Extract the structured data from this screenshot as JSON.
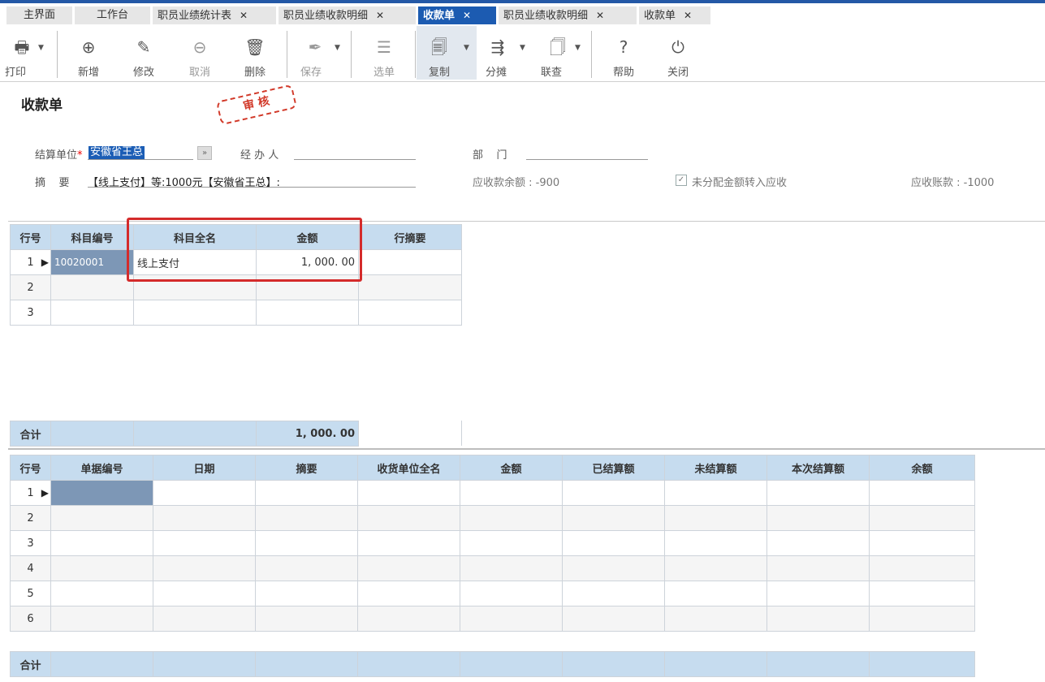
{
  "tabs": [
    {
      "label": "主界面",
      "closable": false,
      "active": false
    },
    {
      "label": "工作台",
      "closable": false,
      "active": false
    },
    {
      "label": "职员业绩统计表",
      "closable": true,
      "active": false
    },
    {
      "label": "职员业绩收款明细",
      "closable": true,
      "active": false
    },
    {
      "label": "收款单",
      "closable": true,
      "active": true
    },
    {
      "label": "职员业绩收款明细",
      "closable": true,
      "active": false
    },
    {
      "label": "收款单",
      "closable": true,
      "active": false
    }
  ],
  "close_glyph": "✕",
  "toolbar": {
    "print": "打印",
    "add": "新增",
    "edit": "修改",
    "cancel": "取消",
    "delete": "删除",
    "save": "保存",
    "select": "选单",
    "copy": "复制",
    "split": "分摊",
    "query": "联查",
    "help": "帮助",
    "close": "关闭"
  },
  "form": {
    "title": "收款单",
    "stamp": "审 核",
    "settle_unit_label": "结算单位",
    "required_mark": "*",
    "settle_unit_value": "安徽省王总",
    "handler_label": "经 办 人",
    "dept_label": "部    门",
    "summary_label": "摘    要",
    "summary_value": "【线上支付】等:1000元【安徽省王总】:",
    "receivable_balance": "应收款余额 : -900",
    "transfer_label": "未分配金额转入应收",
    "receivable_account": "应收账款 : -1000"
  },
  "top_grid": {
    "headers": [
      "行号",
      "科目编号",
      "科目全名",
      "金额",
      "行摘要"
    ],
    "rows": [
      {
        "no": "1",
        "code": "10020001",
        "name": "线上支付",
        "amount": "1, 000. 00",
        "memo": ""
      },
      {
        "no": "2",
        "code": "",
        "name": "",
        "amount": "",
        "memo": ""
      },
      {
        "no": "3",
        "code": "",
        "name": "",
        "amount": "",
        "memo": ""
      }
    ],
    "total_label": "合计",
    "total_amount": "1, 000. 00"
  },
  "bottom_grid": {
    "headers": [
      "行号",
      "单据编号",
      "日期",
      "摘要",
      "收货单位全名",
      "金额",
      "已结算额",
      "未结算额",
      "本次结算额",
      "余额"
    ],
    "rows": [
      "1",
      "2",
      "3",
      "4",
      "5",
      "6"
    ],
    "total_label": "合计"
  }
}
